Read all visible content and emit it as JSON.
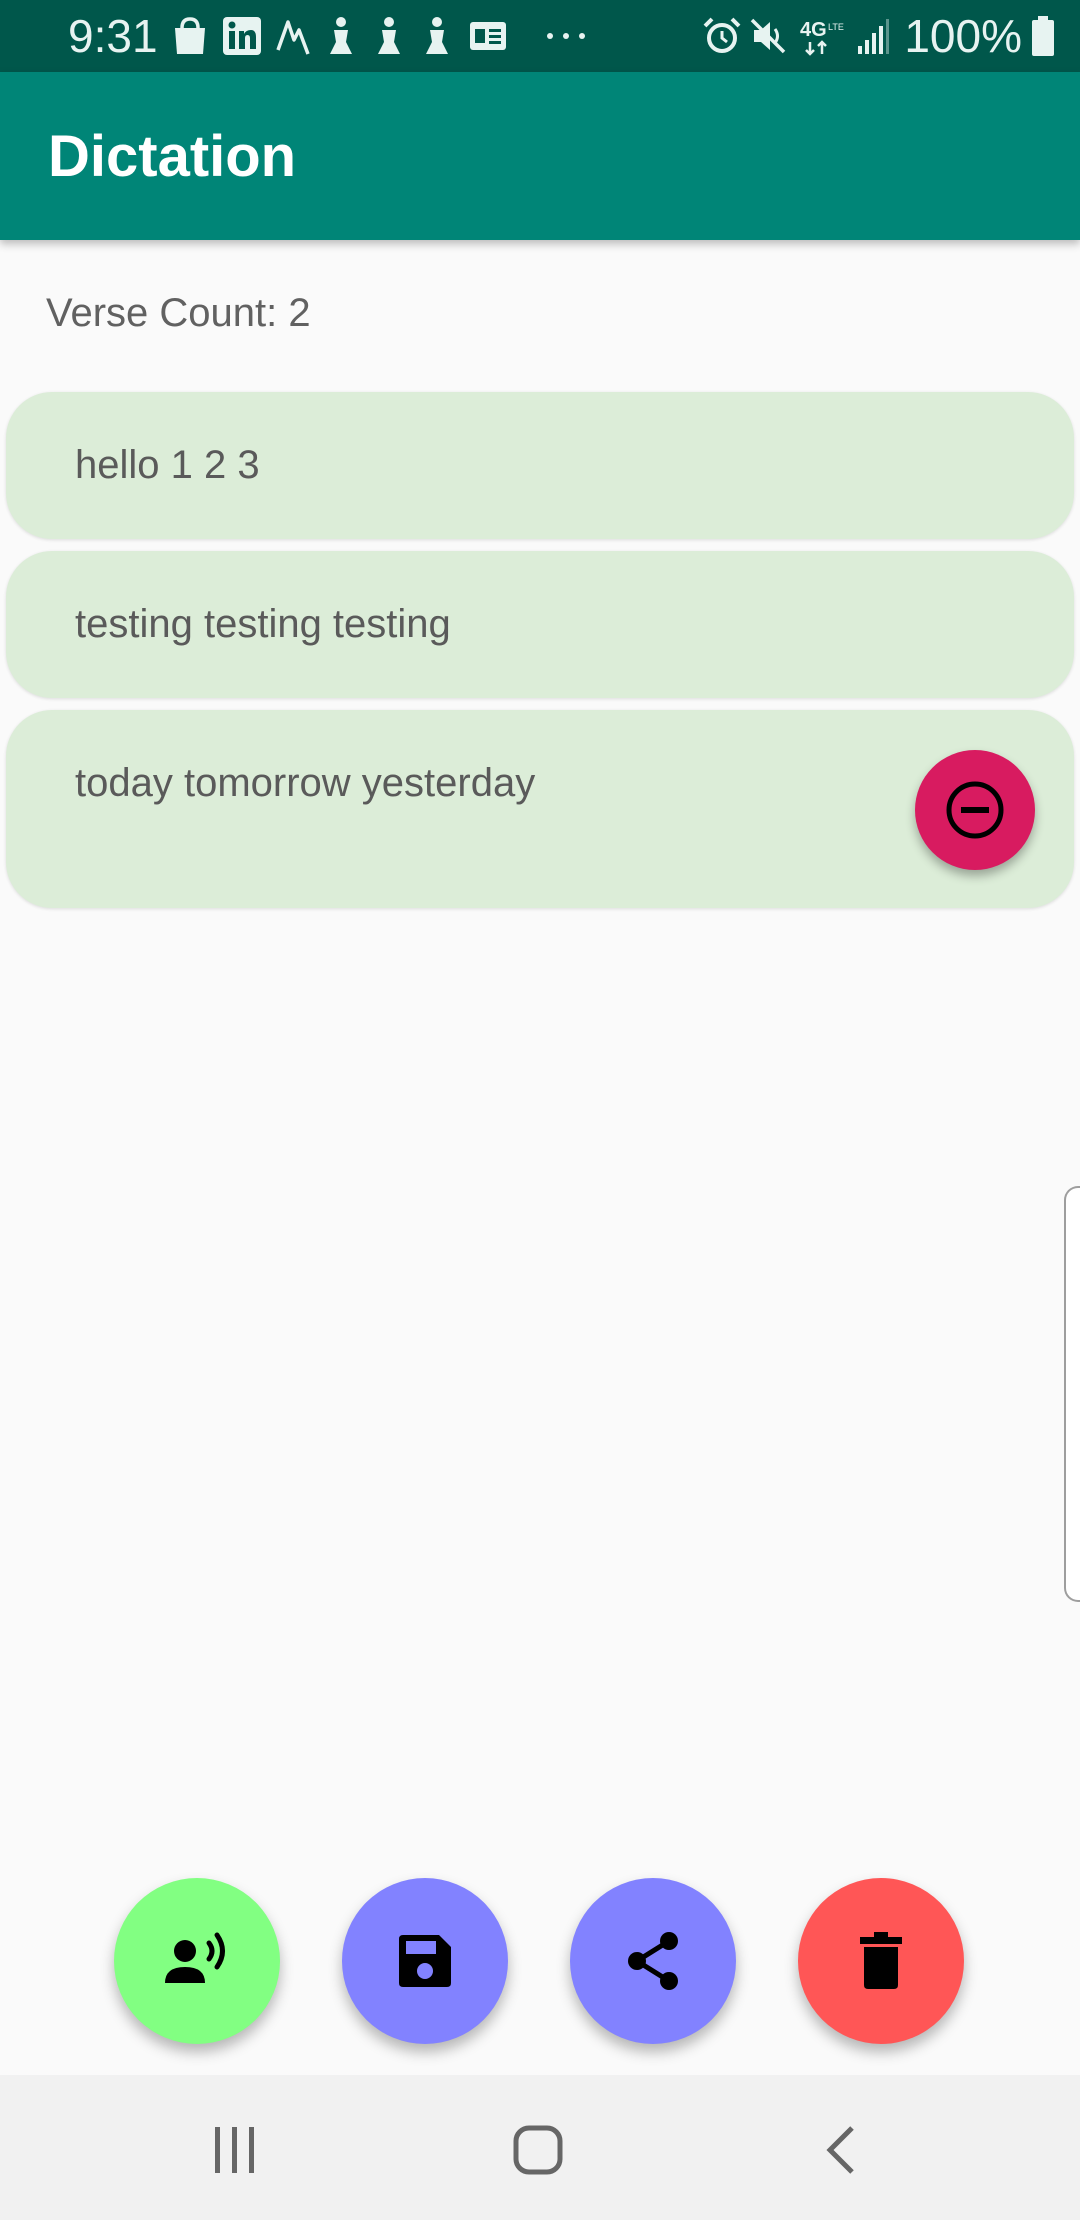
{
  "status_bar": {
    "time": "9:31",
    "battery": "100%",
    "network": "4G",
    "icons_left": [
      "shopping-bag-icon",
      "linkedin-icon",
      "activity-icon",
      "figure-icon",
      "figure-icon",
      "figure-icon",
      "card-icon",
      "more-dots-icon"
    ],
    "icons_right": [
      "alarm-icon",
      "mute-icon",
      "4g-lte-icon",
      "signal-icon",
      "battery-icon"
    ]
  },
  "app_bar": {
    "title": "Dictation",
    "color": "#008577"
  },
  "main": {
    "verse_count": "Verse Count: 2",
    "verses": [
      {
        "text": "hello 1 2 3"
      },
      {
        "text": "testing testing testing"
      },
      {
        "text": "today tomorrow yesterday"
      }
    ],
    "remove_button": {
      "icon": "minus-circle-icon",
      "color": "#d81b60"
    }
  },
  "actions": [
    {
      "name": "dictate-button",
      "icon": "record-voice-icon",
      "color": "#82ff82"
    },
    {
      "name": "save-button",
      "icon": "save-icon",
      "color": "#8282ff"
    },
    {
      "name": "share-button",
      "icon": "share-icon",
      "color": "#8282ff"
    },
    {
      "name": "delete-button",
      "icon": "trash-icon",
      "color": "#ff5656"
    }
  ],
  "nav_bar": {
    "buttons": [
      "recent-apps-icon",
      "home-icon",
      "back-icon"
    ]
  }
}
